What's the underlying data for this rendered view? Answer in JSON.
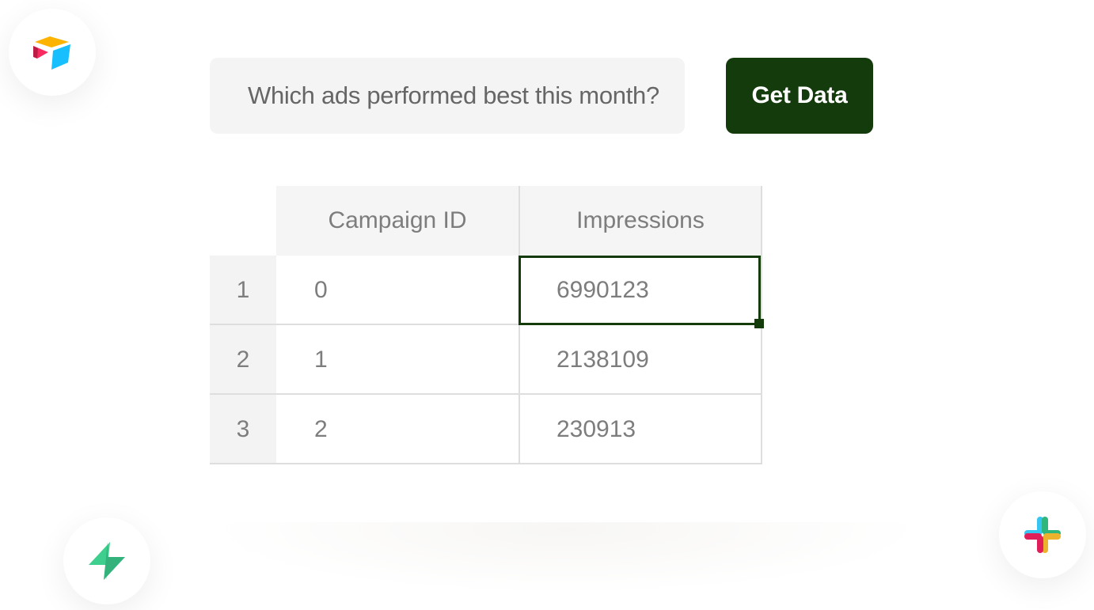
{
  "query": {
    "text": "Which ads performed best this month?"
  },
  "action": {
    "label": "Get Data"
  },
  "table": {
    "columns": [
      "Campaign ID",
      "Impressions"
    ],
    "rows": [
      {
        "index": "1",
        "campaign_id": "0",
        "impressions": "6990123"
      },
      {
        "index": "2",
        "campaign_id": "1",
        "impressions": "2138109"
      },
      {
        "index": "3",
        "campaign_id": "2",
        "impressions": "230913"
      }
    ],
    "selected_cell": {
      "row": 1,
      "column": "Impressions"
    }
  },
  "logos": [
    "airtable-logo",
    "supabase-logo",
    "slack-logo"
  ],
  "colors": {
    "accent": "#143b0b",
    "input_bg": "#f4f4f4",
    "header_bg": "#f5f5f5",
    "text_muted": "#7d7d7d"
  }
}
